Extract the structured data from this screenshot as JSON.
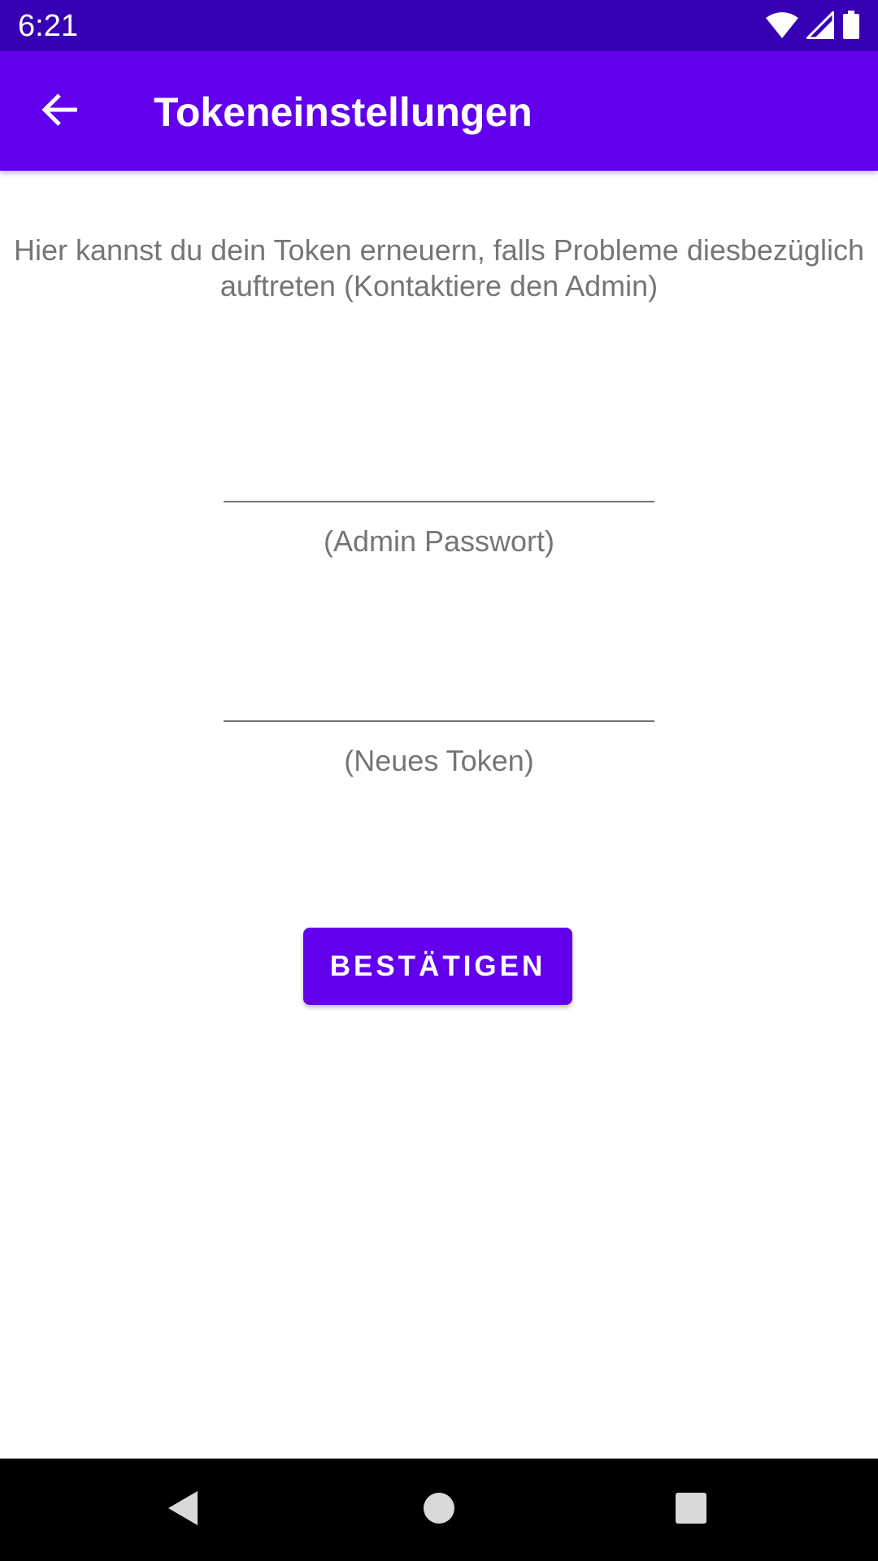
{
  "status_bar": {
    "time": "6:21",
    "icons": [
      "wifi-icon",
      "cell-signal-icon",
      "battery-icon"
    ]
  },
  "app_bar": {
    "title": "Tokeneinstellungen",
    "back_icon": "arrow-back-icon",
    "color": "#6200ee"
  },
  "main": {
    "description": "Hier kannst du dein Token erneuern, falls Probleme diesbezüglich auftreten (Kontaktiere den Admin)",
    "admin_password": {
      "value": "",
      "label": "(Admin Passwort)"
    },
    "new_token": {
      "value": "",
      "label": "(Neues Token)"
    },
    "confirm_label": "BESTÄTIGEN"
  },
  "nav_bar": {
    "buttons": [
      "back-triangle-icon",
      "home-circle-icon",
      "recents-square-icon"
    ]
  },
  "colors": {
    "status_bar": "#3700b3",
    "primary": "#6200ee",
    "secondary_text": "#757575"
  }
}
